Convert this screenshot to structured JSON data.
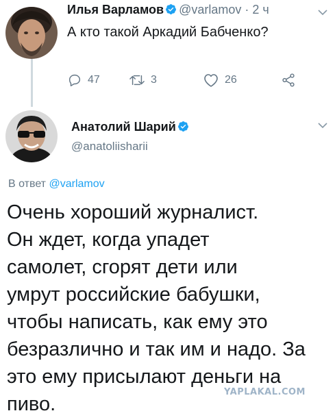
{
  "original_tweet": {
    "author_name": "Илья Варламов",
    "author_handle": "@varlamov",
    "separator": "·",
    "time": "2 ч",
    "text": "А кто такой Аркадий Бабченко?",
    "reply_count": "47",
    "retweet_count": "3",
    "like_count": "26"
  },
  "reply_tweet": {
    "author_name": "Анатолий Шарий",
    "author_handle": "@anatoliisharii",
    "reply_prefix": "В ответ",
    "reply_to": "@varlamov",
    "text_lines": [
      "Очень хороший журналист.",
      "Он ждет, когда упадет",
      "самолет, сгорят дети или",
      "умрут российские бабушки,",
      "чтобы написать, как ему это",
      "безразлично и так им и надо. За",
      "это ему присылают деньги на",
      "пиво."
    ]
  },
  "watermark": "YAPLAKAL.COM",
  "colors": {
    "text": "#14171a",
    "secondary": "#657786",
    "link": "#1da1f2",
    "verified": "#1da1f2",
    "thread_line": "#cfd9de"
  },
  "icons": {
    "reply": "reply-icon",
    "retweet": "retweet-icon",
    "like": "heart-icon",
    "share": "share-icon",
    "verified": "verified-badge-icon",
    "menu": "chevron-down-icon"
  }
}
